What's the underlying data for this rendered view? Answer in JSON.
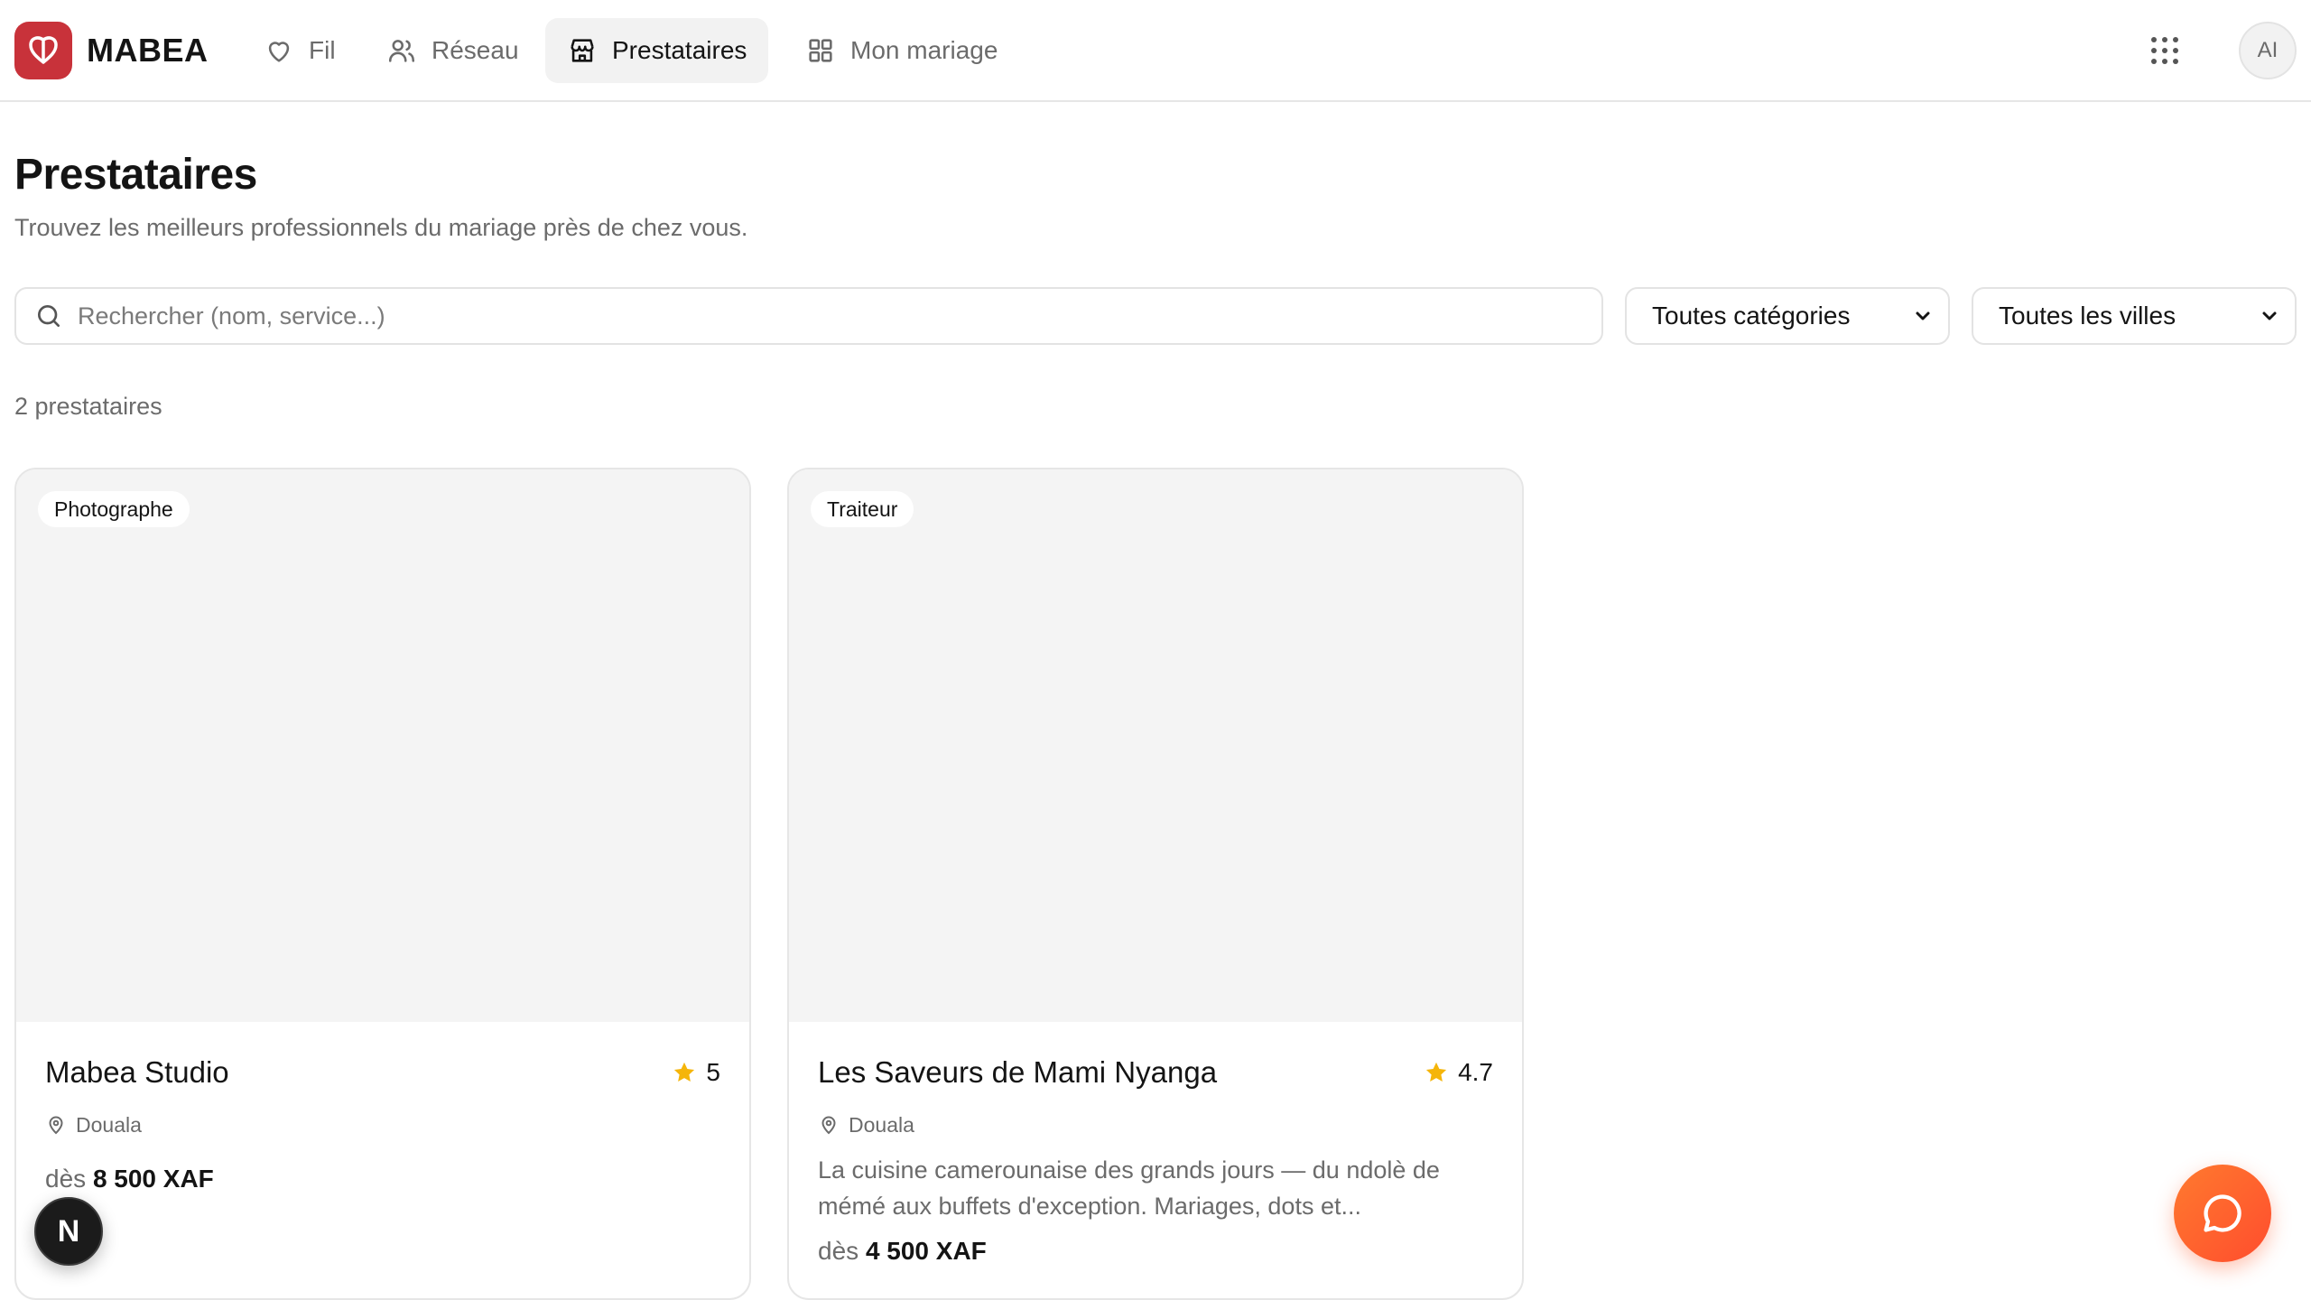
{
  "brand": {
    "name": "MABEA",
    "color": "#c8323a"
  },
  "nav": {
    "items": [
      {
        "label": "Fil",
        "icon": "heart-icon",
        "active": false
      },
      {
        "label": "Réseau",
        "icon": "users-icon",
        "active": false
      },
      {
        "label": "Prestataires",
        "icon": "store-icon",
        "active": true
      },
      {
        "label": "Mon mariage",
        "icon": "grid-icon",
        "active": false
      }
    ],
    "apps_icon": "apps-grid-icon",
    "avatar_initials": "AI"
  },
  "header": {
    "title": "Prestataires",
    "subtitle": "Trouvez les meilleurs professionnels du mariage près de chez vous."
  },
  "filters": {
    "search_placeholder": "Rechercher (nom, service...)",
    "search_value": "",
    "category_selected": "Toutes catégories",
    "city_selected": "Toutes les villes"
  },
  "results": {
    "count_label": "2 prestataires"
  },
  "vendors": [
    {
      "category": "Photographe",
      "name": "Mabea Studio",
      "rating": "5",
      "city": "Douala",
      "description": "",
      "price_prefix": "dès",
      "price_amount": "8 500 XAF"
    },
    {
      "category": "Traiteur",
      "name": "Les Saveurs de Mami Nyanga",
      "rating": "4.7",
      "city": "Douala",
      "description": "La cuisine camerounaise des grands jours — du ndolè de mémé aux buffets d'exception. Mariages, dots et...",
      "price_prefix": "dès",
      "price_amount": "4 500 XAF"
    }
  ],
  "floating": {
    "dev_badge": "N",
    "chat_icon": "chat-bubble-icon"
  },
  "colors": {
    "star": "#f5b50a",
    "fab": "#ff5a2d",
    "muted_text": "#6b6b6b"
  }
}
